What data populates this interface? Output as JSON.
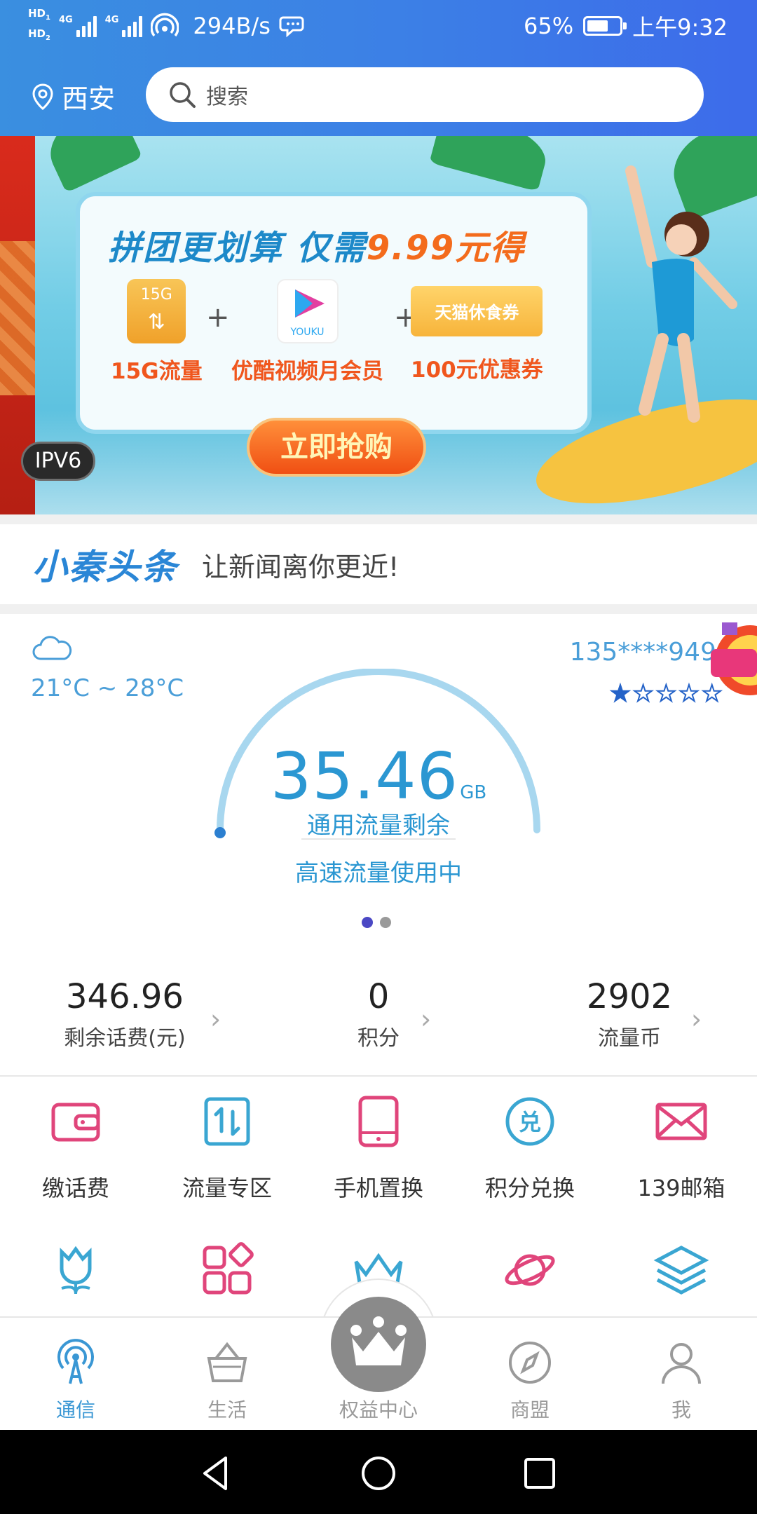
{
  "status_bar": {
    "hd1": "HD",
    "hd1_sub": "1",
    "hd2": "HD",
    "hd2_sub": "2",
    "net1": "4G",
    "net2": "4G",
    "rate": "294B/s",
    "battery_text": "65%",
    "battery_level": 0.65,
    "time": "上午9:32"
  },
  "header": {
    "city": "西安",
    "search_placeholder": "搜索"
  },
  "banner": {
    "title_part1": "拼团更划算  仅需",
    "title_price": "9.99元得",
    "product1_icon_text": "15G",
    "product1_label": "15G流量",
    "product2_icon_text": "YOUKU",
    "product2_label": "优酷视频月会员",
    "product3_icon_text": "天猫休食券",
    "product3_label": "100元优惠券",
    "plus": "+",
    "buy_button": "立即抢购",
    "ipv6_badge": "IPV6",
    "slide_count": 8,
    "active_slide": 0
  },
  "news": {
    "logo": "小秦头条",
    "tagline": "让新闻离你更近!"
  },
  "usage": {
    "weather_icon": "cloud-icon",
    "temperature": "21°C ~ 28°C",
    "phone": "135****949",
    "stars_total": 5,
    "stars_filled": 1,
    "remaining_value": "35.46",
    "remaining_unit": "GB",
    "remaining_label": "通用流量剩余",
    "status": "高速流量使用中",
    "page_count": 2,
    "active_page": 0
  },
  "stats": [
    {
      "value": "346.96",
      "label": "剩余话费(元)"
    },
    {
      "value": "0",
      "label": "积分"
    },
    {
      "value": "2902",
      "label": "流量币"
    }
  ],
  "shortcuts": [
    {
      "label": "缴话费",
      "icon": "wallet-icon"
    },
    {
      "label": "流量专区",
      "icon": "data-transfer-icon"
    },
    {
      "label": "手机置换",
      "icon": "phone-icon"
    },
    {
      "label": "积分兑换",
      "icon": "redeem-icon"
    },
    {
      "label": "139邮箱",
      "icon": "mail-icon"
    }
  ],
  "shortcuts_row2_icons": [
    "tulip-icon",
    "apps-icon",
    "crown-icon",
    "planet-icon",
    "layers-icon"
  ],
  "bottom_nav": [
    {
      "label": "通信",
      "icon": "broadcast-icon",
      "active": true
    },
    {
      "label": "生活",
      "icon": "basket-icon",
      "active": false
    },
    {
      "label": "权益中心",
      "icon": "crown-icon",
      "active": false
    },
    {
      "label": "商盟",
      "icon": "compass-icon",
      "active": false
    },
    {
      "label": "我",
      "icon": "person-icon",
      "active": false
    }
  ],
  "colors": {
    "header_blue": "#3c7fe6",
    "accent_blue": "#2b97d2",
    "pink": "#e0457b",
    "teal": "#3aa6d2",
    "orange": "#f0561d"
  }
}
